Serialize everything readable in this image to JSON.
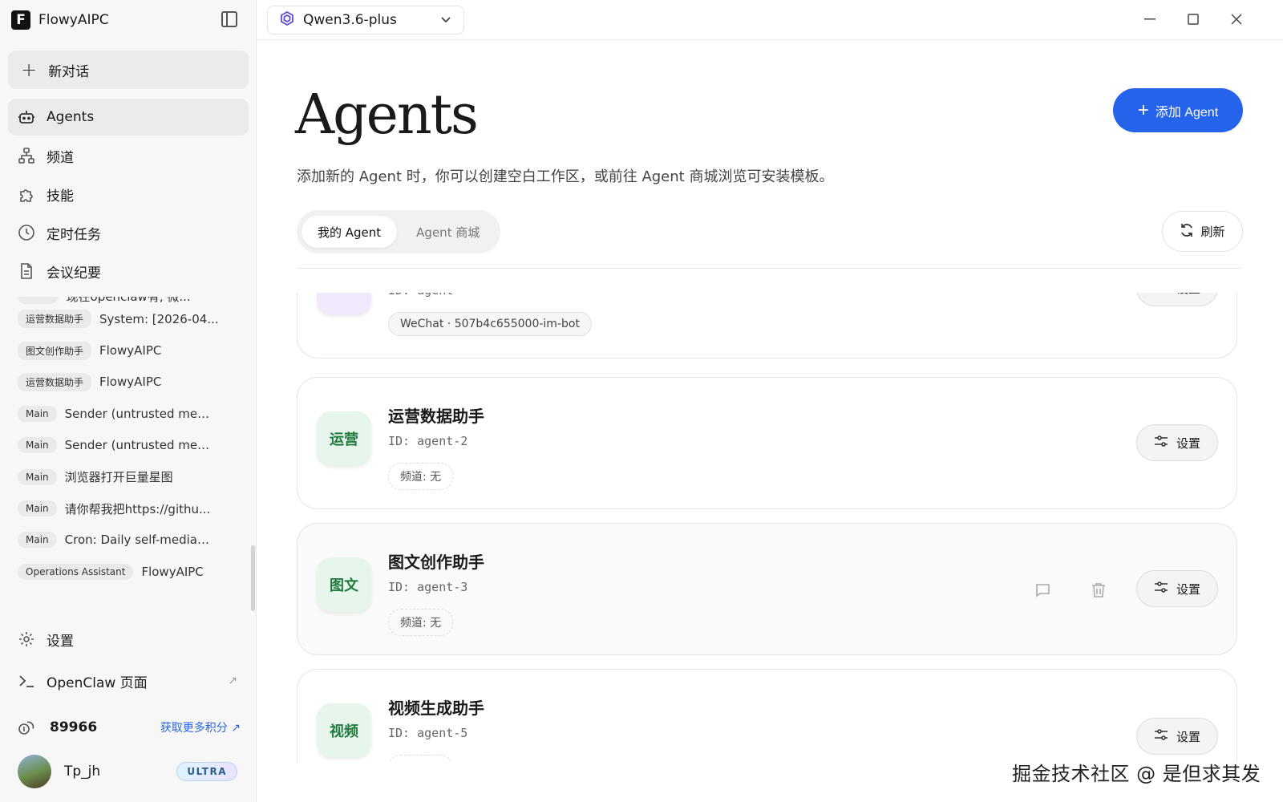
{
  "app": {
    "name": "FlowyAIPC"
  },
  "sidebar": {
    "new_chat": "新对话",
    "nav": [
      {
        "label": "Agents",
        "icon": "robot-icon"
      },
      {
        "label": "频道",
        "icon": "channel-icon"
      },
      {
        "label": "技能",
        "icon": "puzzle-icon"
      },
      {
        "label": "定时任务",
        "icon": "clock-icon"
      },
      {
        "label": "会议纪要",
        "icon": "document-icon"
      }
    ],
    "history_cut": "现在openclaw有, 微...",
    "history": [
      {
        "tag": "运营数据助手",
        "text": "System: [2026-04..."
      },
      {
        "tag": "图文创作助手",
        "text": "FlowyAIPC"
      },
      {
        "tag": "运营数据助手",
        "text": "FlowyAIPC"
      },
      {
        "tag": "Main",
        "text": "Sender (untrusted meta..."
      },
      {
        "tag": "Main",
        "text": "Sender (untrusted meta..."
      },
      {
        "tag": "Main",
        "text": "浏览器打开巨量星图"
      },
      {
        "tag": "Main",
        "text": "请你帮我把https://githu..."
      },
      {
        "tag": "Main",
        "text": "Cron: Daily self-media d..."
      },
      {
        "tag": "Operations Assistant",
        "text": "FlowyAIPC"
      }
    ],
    "settings": "设置",
    "openclaw": "OpenClaw 页面",
    "credits": "89966",
    "credits_link": "获取更多积分",
    "user_name": "Tp_jh",
    "user_badge": "ULTRA"
  },
  "topbar": {
    "model": "Qwen3.6-plus"
  },
  "main": {
    "title": "Agents",
    "subtitle": "添加新的 Agent 时，你可以创建空白工作区，或前往 Agent 商城浏览可安装模板。",
    "add_button": "添加 Agent",
    "tabs": [
      "我的 Agent",
      "Agent 商城"
    ],
    "refresh": "刷新",
    "settings_label": "设置",
    "agents": [
      {
        "name": "",
        "id": "ID: agent",
        "tag": "WeChat · 507b4c655000-im-bot",
        "icon_text": ""
      },
      {
        "name": "运营数据助手",
        "id": "ID: agent-2",
        "tag": "频道: 无",
        "icon_text": "运营"
      },
      {
        "name": "图文创作助手",
        "id": "ID: agent-3",
        "tag": "频道: 无",
        "icon_text": "图文"
      },
      {
        "name": "视频生成助手",
        "id": "ID: agent-5",
        "tag": "",
        "icon_text": "视频"
      }
    ]
  },
  "watermark": "掘金技术社区 @ 是但求其发"
}
